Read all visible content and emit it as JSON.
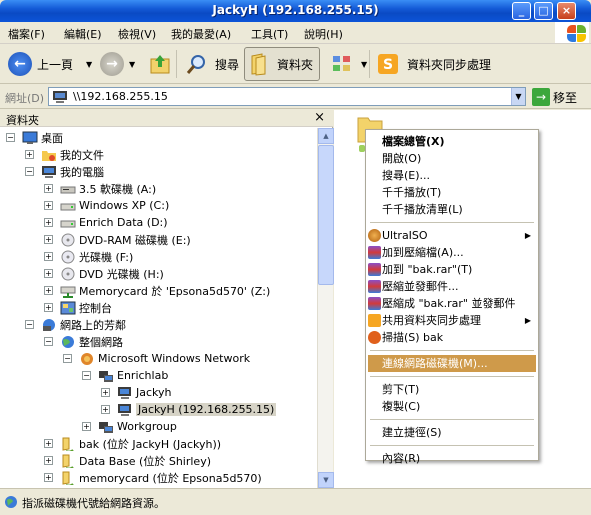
{
  "window": {
    "title": "JackyH (192.168.255.15)"
  },
  "menu": [
    {
      "label": "檔案(F)"
    },
    {
      "label": "編輯(E)"
    },
    {
      "label": "檢視(V)"
    },
    {
      "label": "我的最愛(A)"
    },
    {
      "label": "工具(T)"
    },
    {
      "label": "說明(H)"
    }
  ],
  "toolbar": {
    "back": "上一頁",
    "search": "搜尋",
    "folders": "資料夾",
    "sync": "資料夾同步處理"
  },
  "address": {
    "label": "網址(D)",
    "value": "\\\\192.168.255.15",
    "go": "移至"
  },
  "folder_pane": {
    "title": "資料夾",
    "close": "×",
    "items": [
      {
        "label": "桌面",
        "level": 0,
        "expander": "minus",
        "icon": "desktop-icon"
      },
      {
        "label": "我的文件",
        "level": 1,
        "expander": "plus",
        "icon": "my-documents-icon"
      },
      {
        "label": "我的電腦",
        "level": 1,
        "expander": "minus",
        "icon": "my-computer-icon"
      },
      {
        "label": "3.5 軟碟機 (A:)",
        "level": 2,
        "expander": "plus",
        "icon": "floppy-drive-icon"
      },
      {
        "label": "Windows XP (C:)",
        "level": 2,
        "expander": "plus",
        "icon": "hard-drive-icon"
      },
      {
        "label": "Enrich Data (D:)",
        "level": 2,
        "expander": "plus",
        "icon": "hard-drive-icon"
      },
      {
        "label": "DVD-RAM 磁碟機 (E:)",
        "level": 2,
        "expander": "plus",
        "icon": "dvd-drive-icon"
      },
      {
        "label": "光碟機 (F:)",
        "level": 2,
        "expander": "plus",
        "icon": "cd-drive-icon"
      },
      {
        "label": "DVD 光碟機 (H:)",
        "level": 2,
        "expander": "plus",
        "icon": "dvd-drive-icon"
      },
      {
        "label": "Memorycard 於 'Epsona5d570' (Z:)",
        "level": 2,
        "expander": "plus",
        "icon": "network-drive-icon"
      },
      {
        "label": "控制台",
        "level": 2,
        "expander": "plus",
        "icon": "control-panel-icon"
      },
      {
        "label": "網路上的芳鄰",
        "level": 1,
        "expander": "minus",
        "icon": "network-places-icon"
      },
      {
        "label": "整個網路",
        "level": 2,
        "expander": "minus",
        "icon": "entire-network-icon"
      },
      {
        "label": "Microsoft Windows Network",
        "level": 3,
        "expander": "minus",
        "icon": "windows-network-icon"
      },
      {
        "label": "Enrichlab",
        "level": 4,
        "expander": "minus",
        "icon": "workgroup-icon"
      },
      {
        "label": "Jackyh",
        "level": 5,
        "expander": "plus",
        "icon": "computer-icon"
      },
      {
        "label": "JackyH (192.168.255.15)",
        "level": 5,
        "expander": "plus",
        "icon": "computer-icon",
        "selected": true
      },
      {
        "label": "Workgroup",
        "level": 4,
        "expander": "plus",
        "icon": "workgroup-icon"
      },
      {
        "label": "bak (位於 JackyH (Jackyh))",
        "level": 2,
        "expander": "plus",
        "icon": "shared-folder-icon"
      },
      {
        "label": "Data Base (位於 Shirley)",
        "level": 2,
        "expander": "plus",
        "icon": "shared-folder-icon"
      },
      {
        "label": "memorycard (位於 Epsona5d570)",
        "level": 2,
        "expander": "plus",
        "icon": "shared-folder-icon"
      }
    ]
  },
  "context_menu": {
    "items": [
      {
        "label": "檔案總管(X)",
        "bold": true
      },
      {
        "label": "開啟(O)"
      },
      {
        "label": "搜尋(E)..."
      },
      {
        "label": "千千播放(T)"
      },
      {
        "label": "千千播放清單(L)"
      },
      {
        "sep": true
      },
      {
        "label": "UltraISO",
        "icon": "ultraiso-icon",
        "submenu": true
      },
      {
        "label": "加到壓縮檔(A)...",
        "icon": "winrar-icon"
      },
      {
        "label": "加到 \"bak.rar\"(T)",
        "icon": "winrar-icon"
      },
      {
        "label": "壓縮並發郵件...",
        "icon": "winrar-icon"
      },
      {
        "label": "壓縮成 \"bak.rar\" 並發郵件",
        "icon": "winrar-icon"
      },
      {
        "label": "共用資料夾同步處理",
        "icon": "sync-icon",
        "submenu": true
      },
      {
        "label": "掃描(S) bak",
        "icon": "antivirus-icon"
      },
      {
        "sep": true
      },
      {
        "label": "連線網路磁碟機(M)...",
        "highlighted": true
      },
      {
        "sep": true
      },
      {
        "label": "剪下(T)"
      },
      {
        "label": "複製(C)"
      },
      {
        "sep": true
      },
      {
        "label": "建立捷徑(S)"
      },
      {
        "sep": true
      },
      {
        "label": "內容(R)"
      }
    ]
  },
  "status_bar": {
    "text": "指派磁碟機代號給網路資源。"
  },
  "colors": {
    "title_bar": "#0a4ac4",
    "highlight": "#cf9a4a",
    "selection": "#d6d3c6"
  }
}
